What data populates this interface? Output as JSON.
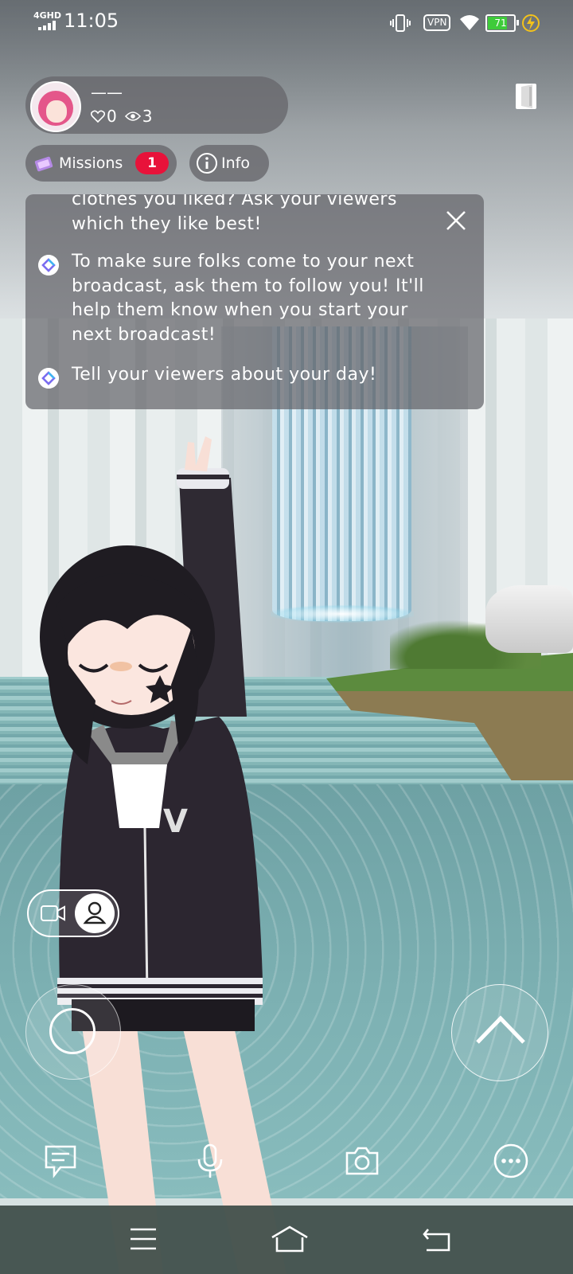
{
  "status_bar": {
    "network": "4GHD",
    "time": "11:05",
    "vpn": "VPN",
    "battery": "71"
  },
  "profile": {
    "name": "——",
    "likes": "0",
    "viewers": "3"
  },
  "buttons": {
    "missions_label": "Missions",
    "missions_count": "1",
    "info_label": "Info"
  },
  "tips": [
    "clothes you liked? Ask your viewers which they like best!",
    "To make sure folks come to your next broadcast, ask them to follow you! It'll help them know when you start your next broadcast!",
    "Tell your viewers about your day!"
  ],
  "icons": {
    "status": [
      "signal-icon",
      "vibrate-icon",
      "vpn-icon",
      "wifi-icon",
      "battery-icon",
      "charging-icon"
    ],
    "toolbar": [
      "chat-icon",
      "microphone-icon",
      "camera-icon",
      "more-icon"
    ],
    "nav": [
      "menu-icon",
      "home-icon",
      "back-icon"
    ]
  },
  "colors": {
    "badge": "#e8123a",
    "battery": "#3ecb3a",
    "charging": "#f3c21b"
  }
}
